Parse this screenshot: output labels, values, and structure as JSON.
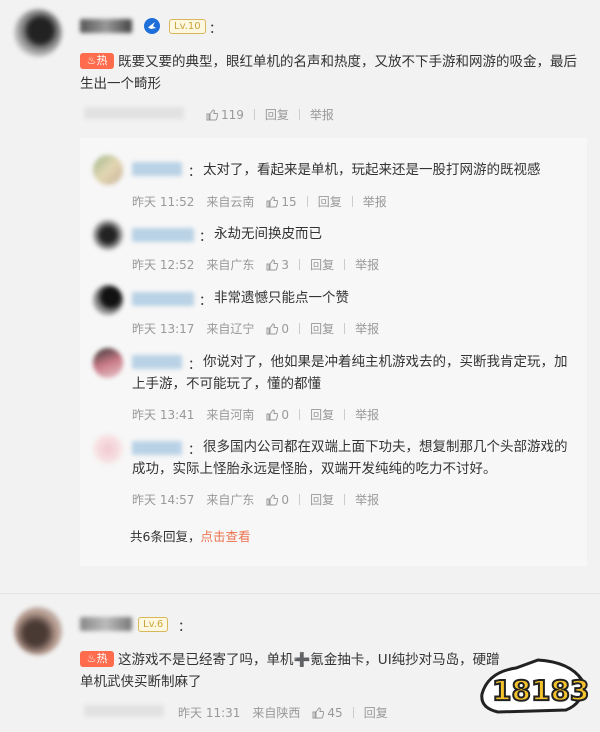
{
  "comments": [
    {
      "level": "Lv.10",
      "hot_label": "热",
      "text": "既要又要的典型，眼红单机的名声和热度，又放不下手游和网游的吸金，最后生出一个畸形",
      "likes": "119",
      "reply_label": "回复",
      "report_label": "举报",
      "colon": "："
    },
    {
      "level": "Lv.6",
      "hot_label": "热",
      "text": "这游戏不是已经寄了吗，单机➕氪金抽卡，UI纯抄对马岛，硬蹭单机武侠买断制麻了",
      "time": "昨天 11:31",
      "location": "来自陕西",
      "likes": "45",
      "reply_label": "回复",
      "colon": "："
    }
  ],
  "replies": [
    {
      "text": "太对了，看起来是单机，玩起来还是一股打网游的既视感",
      "time": "昨天 11:52",
      "location": "来自云南",
      "likes": "15"
    },
    {
      "text": "永劫无间换皮而已",
      "time": "昨天 12:52",
      "location": "来自广东",
      "likes": "3"
    },
    {
      "text": "非常遗憾只能点一个赞",
      "time": "昨天 13:17",
      "location": "来自辽宁",
      "likes": "0"
    },
    {
      "text": "你说对了，他如果是冲着纯主机游戏去的，买断我肯定玩，加上手游，不可能玩了，懂的都懂",
      "time": "昨天 13:41",
      "location": "来自河南",
      "likes": "0"
    },
    {
      "text": "很多国内公司都在双端上面下功夫，想复制那几个头部游戏的成功，实际上怪胎永远是怪胎，双端开发纯纯的吃力不讨好。",
      "time": "昨天 14:57",
      "location": "来自广东",
      "likes": "0"
    }
  ],
  "reply_common": {
    "reply_label": "回复",
    "report_label": "举报",
    "colon": "："
  },
  "more_replies": {
    "count_text": "共6条回复，",
    "link_text": "点击查看"
  },
  "watermark": {
    "text": "18183"
  },
  "colors": {
    "hot": "#ff6b4d",
    "link": "#eb7350",
    "level": "#c8a43a"
  },
  "icons": {
    "like": "thumb-up-icon",
    "verified": "verified-badge-icon",
    "hot": "flame-icon"
  }
}
